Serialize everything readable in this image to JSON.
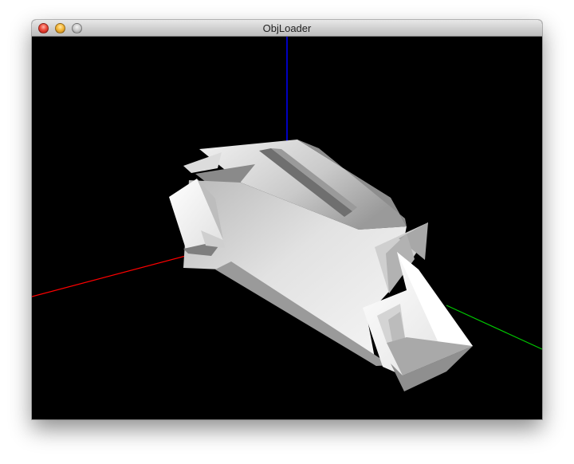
{
  "window": {
    "title": "ObjLoader",
    "controls": {
      "close": "close-icon",
      "minimize": "minimize-icon",
      "zoom": "zoom-icon"
    }
  },
  "viewport": {
    "background": "#000000",
    "axes": {
      "x_color": "#ff0000",
      "y_color": "#0000ff",
      "z_color": "#00ff00"
    },
    "model_color": "#e6e6e6"
  }
}
